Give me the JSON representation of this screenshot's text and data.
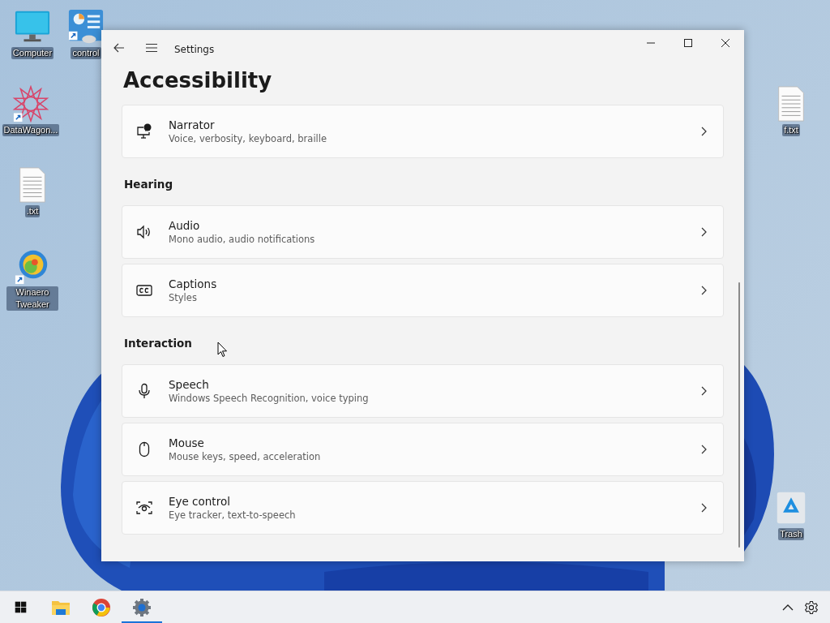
{
  "desktop_icons": [
    {
      "label": "Computer"
    },
    {
      "label": "control"
    },
    {
      "label": "DataWagon..."
    },
    {
      "label": ".txt"
    },
    {
      "label": "Winaero Tweaker"
    },
    {
      "label": "f.txt"
    },
    {
      "label": "Trash"
    }
  ],
  "window": {
    "title": "Settings",
    "heading": "Accessibility",
    "sections": [
      {
        "items": [
          {
            "title": "Narrator",
            "subtitle": "Voice, verbosity, keyboard, braille"
          }
        ]
      },
      {
        "heading": "Hearing",
        "items": [
          {
            "title": "Audio",
            "subtitle": "Mono audio, audio notifications"
          },
          {
            "title": "Captions",
            "subtitle": "Styles"
          }
        ]
      },
      {
        "heading": "Interaction",
        "items": [
          {
            "title": "Speech",
            "subtitle": "Windows Speech Recognition, voice typing"
          },
          {
            "title": "Mouse",
            "subtitle": "Mouse keys, speed, acceleration"
          },
          {
            "title": "Eye control",
            "subtitle": "Eye tracker, text-to-speech"
          }
        ]
      }
    ]
  },
  "taskbar": {
    "apps": [
      {
        "selected": false
      },
      {
        "selected": false
      },
      {
        "selected": false
      },
      {
        "selected": true
      }
    ]
  }
}
